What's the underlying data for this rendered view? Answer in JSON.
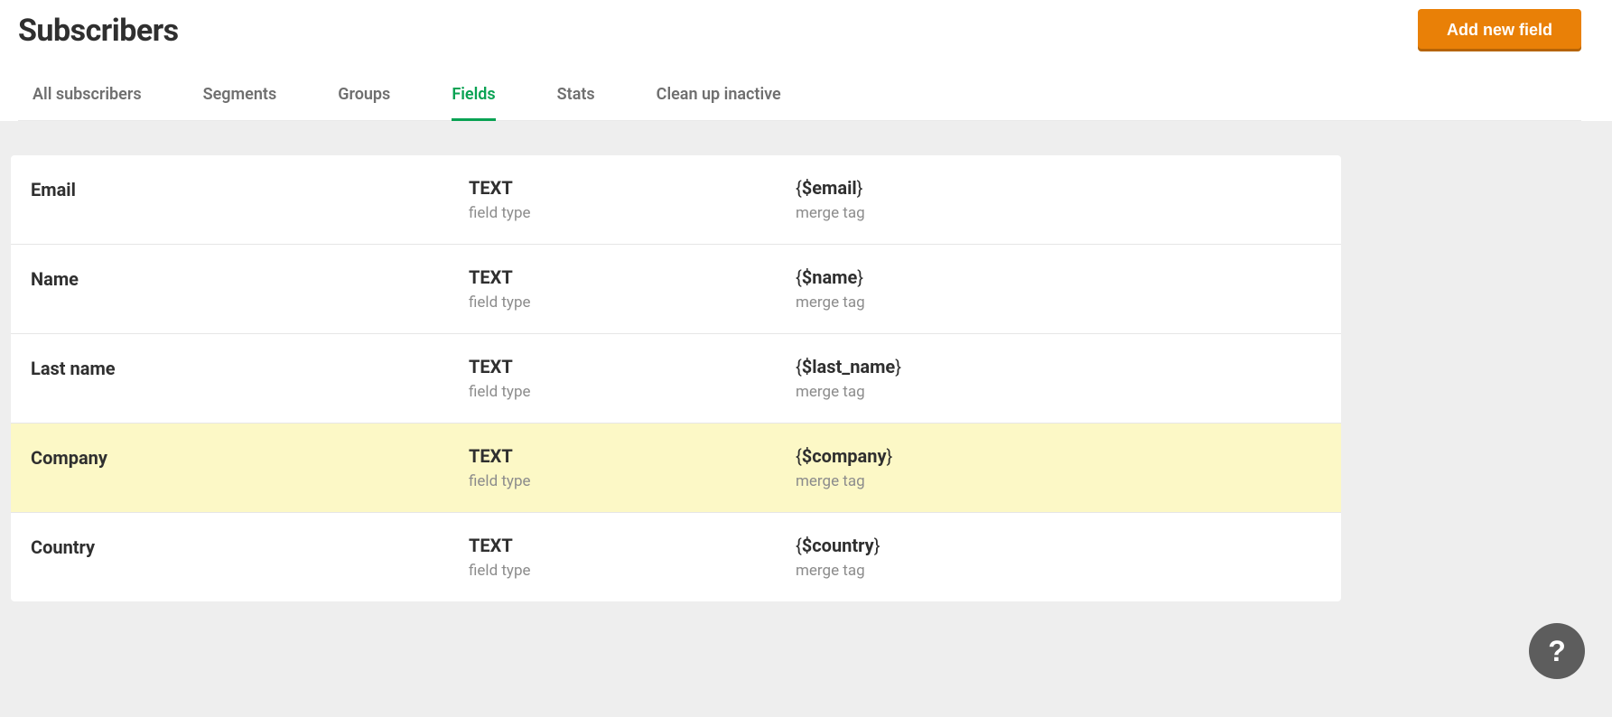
{
  "header": {
    "title": "Subscribers",
    "add_button_label": "Add new field"
  },
  "tabs": [
    {
      "label": "All subscribers",
      "active": false
    },
    {
      "label": "Segments",
      "active": false
    },
    {
      "label": "Groups",
      "active": false
    },
    {
      "label": "Fields",
      "active": true
    },
    {
      "label": "Stats",
      "active": false
    },
    {
      "label": "Clean up inactive",
      "active": false
    }
  ],
  "labels": {
    "field_type": "field type",
    "merge_tag": "merge tag"
  },
  "fields": [
    {
      "name": "Email",
      "type": "TEXT",
      "tag_open": "{",
      "tag_var": "$email",
      "tag_close": "}",
      "highlight": false
    },
    {
      "name": "Name",
      "type": "TEXT",
      "tag_open": "{",
      "tag_var": "$name",
      "tag_close": "}",
      "highlight": false
    },
    {
      "name": "Last name",
      "type": "TEXT",
      "tag_open": "{",
      "tag_var": "$last_name",
      "tag_close": "}",
      "highlight": false
    },
    {
      "name": "Company",
      "type": "TEXT",
      "tag_open": "{",
      "tag_var": "$company",
      "tag_close": "}",
      "highlight": true
    },
    {
      "name": "Country",
      "type": "TEXT",
      "tag_open": "{",
      "tag_var": "$country",
      "tag_close": "}",
      "highlight": false
    }
  ],
  "help": {
    "glyph": "?"
  }
}
